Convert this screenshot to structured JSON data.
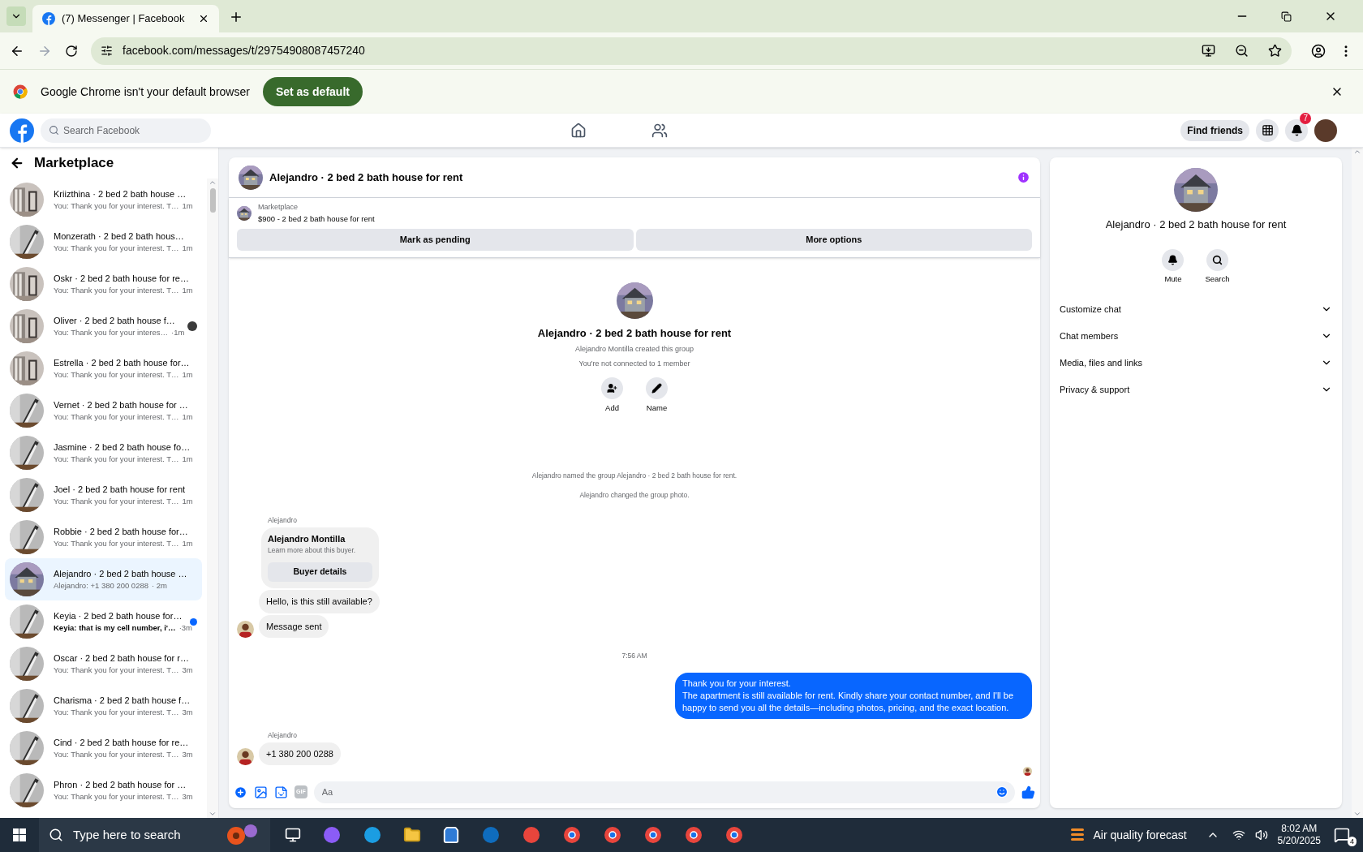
{
  "browser": {
    "tab_title": "(7) Messenger | Facebook",
    "url": "facebook.com/messages/t/29754908087457240",
    "infobar": {
      "text": "Google Chrome isn't your default browser",
      "button": "Set as default"
    }
  },
  "header": {
    "search_placeholder": "Search Facebook",
    "find_friends": "Find friends",
    "notification_count": "7"
  },
  "sidebar": {
    "title": "Marketplace",
    "conversations": [
      {
        "name": "Kriizthina · 2 bed 2 bath house …",
        "snippet": "You: Thank you for your interest. T…",
        "time": "1m",
        "picture": {
          "kind": "room"
        },
        "selected": false,
        "unread": false,
        "seen": false
      },
      {
        "name": "Monzerath · 2 bed 2 bath hous…",
        "snippet": "You: Thank you for your interest. T…",
        "time": "1m",
        "picture": {
          "kind": "stairs"
        },
        "selected": false,
        "unread": false,
        "seen": false
      },
      {
        "name": "Oskr · 2 bed 2 bath house for re…",
        "snippet": "You: Thank you for your interest. T…",
        "time": "1m",
        "picture": {
          "kind": "room"
        },
        "selected": false,
        "unread": false,
        "seen": false
      },
      {
        "name": "Oliver · 2 bed 2 bath house f…",
        "snippet": "You: Thank you for your interes…",
        "time": "·1m",
        "picture": {
          "kind": "room"
        },
        "selected": false,
        "unread": false,
        "seen": true
      },
      {
        "name": "Estrella · 2 bed 2 bath house for…",
        "snippet": "You: Thank you for your interest. T…",
        "time": "1m",
        "picture": {
          "kind": "room"
        },
        "selected": false,
        "unread": false,
        "seen": false
      },
      {
        "name": "Vernet · 2 bed 2 bath house for …",
        "snippet": "You: Thank you for your interest. T…",
        "time": "1m",
        "picture": {
          "kind": "stairs"
        },
        "selected": false,
        "unread": false,
        "seen": false
      },
      {
        "name": "Jasmine · 2 bed 2 bath house fo…",
        "snippet": "You: Thank you for your interest. T…",
        "time": "1m",
        "picture": {
          "kind": "stairs"
        },
        "selected": false,
        "unread": false,
        "seen": false
      },
      {
        "name": "Joel · 2 bed 2 bath house for rent",
        "snippet": "You: Thank you for your interest. T…",
        "time": "1m",
        "picture": {
          "kind": "stairs"
        },
        "selected": false,
        "unread": false,
        "seen": false
      },
      {
        "name": "Robbie · 2 bed 2 bath house for…",
        "snippet": "You: Thank you for your interest. T…",
        "time": "1m",
        "picture": {
          "kind": "stairs"
        },
        "selected": false,
        "unread": false,
        "seen": false
      },
      {
        "name": "Alejandro · 2 bed 2 bath house …",
        "snippet": "Alejandro: +1 380 200 0288",
        "time": "· 2m",
        "picture": {
          "kind": "house"
        },
        "selected": true,
        "unread": false,
        "seen": false
      },
      {
        "name": "Keyia · 2 bed 2 bath house for…",
        "snippet": "Keyia: that is my cell number, i'…",
        "time": "·3m",
        "picture": {
          "kind": "stairs"
        },
        "selected": false,
        "unread": true,
        "seen": false
      },
      {
        "name": "Oscar · 2 bed 2 bath house for r…",
        "snippet": "You: Thank you for your interest. T…",
        "time": "3m",
        "picture": {
          "kind": "stairs"
        },
        "selected": false,
        "unread": false,
        "seen": false
      },
      {
        "name": "Charisma · 2 bed 2 bath house f…",
        "snippet": "You: Thank you for your interest. T…",
        "time": "3m",
        "picture": {
          "kind": "stairs"
        },
        "selected": false,
        "unread": false,
        "seen": false
      },
      {
        "name": "Cind · 2 bed 2 bath house for re…",
        "snippet": "You: Thank you for your interest. T…",
        "time": "3m",
        "picture": {
          "kind": "stairs"
        },
        "selected": false,
        "unread": false,
        "seen": false
      },
      {
        "name": "Phron · 2 bed 2 bath house for …",
        "snippet": "You: Thank you for your interest. T…",
        "time": "3m",
        "picture": {
          "kind": "stairs"
        },
        "selected": false,
        "unread": false,
        "seen": false
      }
    ]
  },
  "chat": {
    "title": "Alejandro · 2 bed 2 bath house for rent",
    "listing": {
      "label": "Marketplace",
      "title": "$900 - 2 bed 2 bath house for rent",
      "buttons": [
        "Mark as pending",
        "More options"
      ]
    },
    "intro": {
      "title": "Alejandro · 2 bed 2 bath house for rent",
      "lines": [
        "Alejandro Montilla created this group",
        "You're not connected to 1 member"
      ],
      "actions": [
        "Add",
        "Name"
      ]
    },
    "messages": [
      {
        "kind": "system",
        "text": "Alejandro named the group Alejandro · 2 bed 2 bath house for rent."
      },
      {
        "kind": "system",
        "text": "Alejandro changed the group photo."
      },
      {
        "kind": "sender",
        "text": "Alejandro"
      },
      {
        "kind": "card",
        "title": "Alejandro Montilla",
        "text": "Learn more about this buyer.",
        "button": "Buyer details"
      },
      {
        "kind": "incoming",
        "text": "Hello, is this still available?",
        "avatar": false
      },
      {
        "kind": "incoming",
        "text": "Message sent",
        "avatar": true
      },
      {
        "kind": "time",
        "text": "7:56 AM"
      },
      {
        "kind": "outgoing",
        "lines": [
          "Thank you for your interest.",
          "The apartment is still available for rent. Kindly share your contact number, and I'll be happy to send you all the details—including photos, pricing, and the exact location."
        ]
      },
      {
        "kind": "sender",
        "text": "Alejandro"
      },
      {
        "kind": "incoming",
        "text": "+1 380 200 0288",
        "avatar": true
      }
    ],
    "composer": {
      "gif_label": "GIF",
      "placeholder": "Aa"
    }
  },
  "details": {
    "title": "Alejandro · 2 bed 2 bath house for rent",
    "actions": [
      "Mute",
      "Search"
    ],
    "sections": [
      {
        "label": "Customize chat",
        "expanded": false
      },
      {
        "label": "Chat members",
        "expanded": false
      },
      {
        "label": "Media, files and links",
        "expanded": false
      },
      {
        "label": "Privacy & support",
        "expanded": false
      }
    ]
  },
  "taskbar": {
    "search_placeholder": "Type here to search",
    "weather": "Air quality forecast",
    "time": "8:02 AM",
    "date": "5/20/2025",
    "notifications": "4"
  }
}
